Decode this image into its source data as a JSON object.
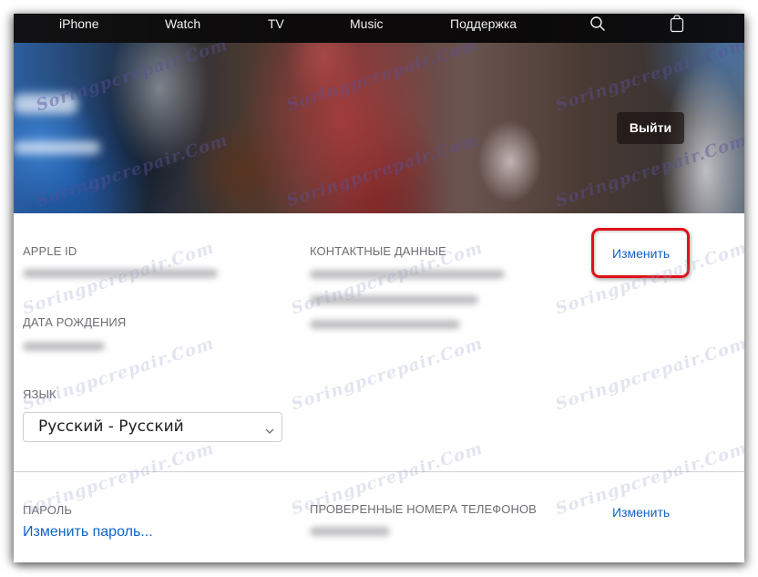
{
  "nav": {
    "items": [
      {
        "label": "iPhone"
      },
      {
        "label": "Watch"
      },
      {
        "label": "TV"
      },
      {
        "label": "Music"
      },
      {
        "label": "Поддержка"
      }
    ],
    "search_icon": "search-icon",
    "bag_icon": "shopping-bag-icon"
  },
  "hero": {
    "name_blurred": "[blurred name]",
    "email_blurred": "[blurred email]",
    "signout_label": "Выйти"
  },
  "account": {
    "apple_id": {
      "label": "APPLE ID",
      "value": "[blurred email]"
    },
    "birthday": {
      "label": "ДАТА РОЖДЕНИЯ",
      "value": "[blurred date]"
    },
    "language": {
      "label": "ЯЗЫК",
      "selected": "Русский - Русский"
    },
    "contact": {
      "label": "КОНТАКТНЫЕ ДАННЫЕ",
      "values": [
        "[blurred email 1]",
        "[blurred email 2]",
        "[blurred email 3]"
      ],
      "edit_label": "Изменить"
    }
  },
  "security": {
    "password": {
      "label": "ПАРОЛЬ",
      "link": "Изменить пароль..."
    },
    "phones": {
      "label": "ПРОВЕРЕННЫЕ НОМЕРА ТЕЛЕФОНОВ",
      "value": "[blurred phone]",
      "edit_label": "Изменить"
    }
  },
  "watermark": "Soringpcrepair.Com",
  "colors": {
    "link": "#0f63c9",
    "highlight": "#e0101a",
    "label": "#6e6e73",
    "nav_bg": "#0c0a0a"
  }
}
